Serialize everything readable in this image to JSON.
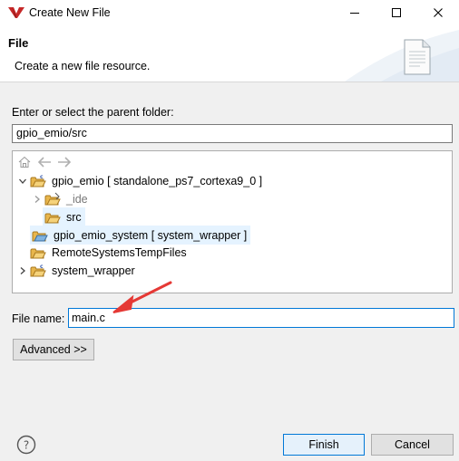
{
  "window": {
    "title": "Create New File",
    "controls": {
      "minimize": "—",
      "maximize": "☐",
      "close": "✕"
    }
  },
  "header": {
    "title": "File",
    "description": "Create a new file resource.",
    "icon": "new-file-wizard-icon"
  },
  "parent_folder": {
    "label": "Enter or select the parent folder:",
    "value": "gpio_emio/src"
  },
  "tree": {
    "toolbar": [
      "home-icon",
      "back-arrow-icon",
      "forward-arrow-icon"
    ],
    "items": [
      {
        "label": "gpio_emio [ standalone_ps7_cortexa9_0 ]",
        "expanded": true,
        "icon": "c-project-folder-icon"
      },
      {
        "label": "_ide",
        "expanded": false,
        "icon": "folder-icon"
      },
      {
        "label": "src",
        "selected": true,
        "icon": "open-folder-icon"
      },
      {
        "label": "gpio_emio_system [ system_wrapper ]",
        "icon": "system-project-icon"
      },
      {
        "label": "RemoteSystemsTempFiles",
        "icon": "project-folder-icon"
      },
      {
        "label": "system_wrapper",
        "expanded": false,
        "icon": "c-project-folder-icon"
      }
    ]
  },
  "file_name": {
    "label": "File name:",
    "value": "main.c"
  },
  "buttons": {
    "advanced": "Advanced >>",
    "finish": "Finish",
    "cancel": "Cancel",
    "help": "?"
  },
  "colors": {
    "accent": "#0078d7",
    "selection": "#e5f3ff",
    "annotation_arrow": "#e53935",
    "folder": "#e8b64c"
  }
}
